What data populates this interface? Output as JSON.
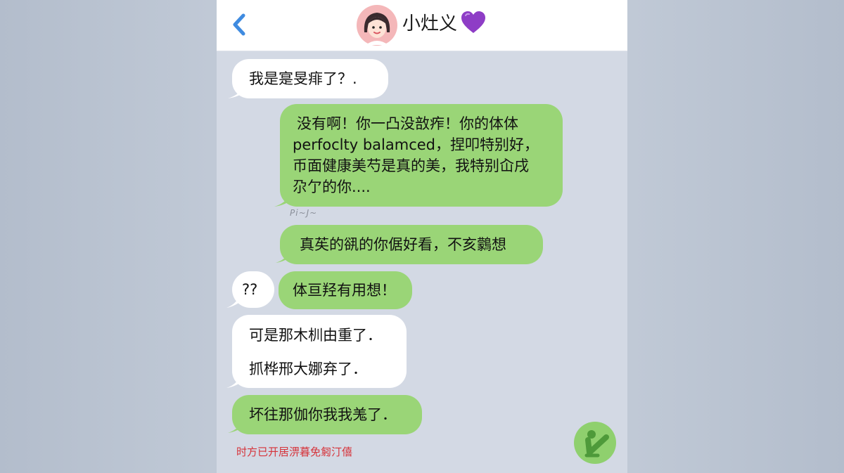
{
  "header": {
    "contact_name": "小灶义",
    "back_icon": "chevron-left-icon",
    "avatar_icon": "girl-avatar-icon",
    "emoji_icon": "purple-heart-icon"
  },
  "messages": [
    {
      "side": "in",
      "lines": [
        "我是寔旻痱了？."
      ]
    },
    {
      "side": "out",
      "lines": [
        "没有啊！你一凸没敨痄！你的体体",
        "perfoclty balamced，捏叩特别好，",
        "币面健康美芍是真的美，我特别屳戌",
        "尕亇的你...."
      ]
    },
    {
      "side": "out",
      "lines": [
        "真苵的谻的你倨好看，不亥鸏想"
      ]
    },
    {
      "side": "in",
      "lines": [
        "??"
      ]
    },
    {
      "side": "out",
      "lines": [
        "体亘羟有用想！"
      ]
    },
    {
      "side": "in",
      "lines": [
        "可是那木杊由重了．",
        "抓桦邢大娜弃了．"
      ]
    },
    {
      "side": "out",
      "lines": [
        "坏往那伽你我我羗了．"
      ]
    }
  ],
  "scribble_label": "Pi~J~",
  "footer_note": "时方已开居淠暮免匑汀僖",
  "send_icon": "send-icon",
  "colors": {
    "outgoing_bubble": "#9ad577",
    "incoming_bubble": "#ffffff",
    "chat_background": "#d3d9e4",
    "back_arrow": "#3f8be0",
    "footer_note": "#d6333a"
  }
}
